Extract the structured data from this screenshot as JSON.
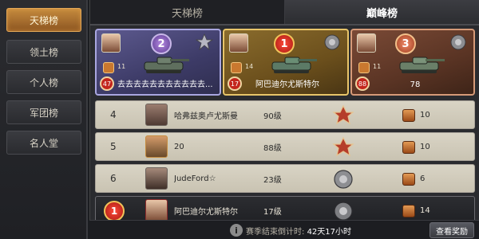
{
  "sidebar": {
    "items": [
      {
        "label": "天梯榜",
        "active": true
      },
      {
        "label": "领土榜",
        "active": false
      },
      {
        "label": "个人榜",
        "active": false
      },
      {
        "label": "军团榜",
        "active": false
      },
      {
        "label": "名人堂",
        "active": false
      }
    ]
  },
  "tabs": [
    {
      "label": "天梯榜",
      "active": false
    },
    {
      "label": "巅峰榜",
      "active": true
    }
  ],
  "top3": [
    {
      "rank": "2",
      "mini_value": "11",
      "level": "47",
      "name": "去去去去去去去去去去去..."
    },
    {
      "rank": "1",
      "mini_value": "14",
      "level": "17",
      "name": "阿巴迪尔尤斯特尔"
    },
    {
      "rank": "3",
      "mini_value": "11",
      "level": "88",
      "name": "78"
    }
  ],
  "rows": [
    {
      "rank": "4",
      "name": "哈弗兹奥卢尤斯曼",
      "level": "90级",
      "score": "10"
    },
    {
      "rank": "5",
      "name": "20",
      "level": "88级",
      "score": "10"
    },
    {
      "rank": "6",
      "name": "JudeFord☆",
      "level": "23级",
      "score": "6"
    }
  ],
  "me": {
    "rank": "1",
    "name": "阿巴迪尔尤斯特尔",
    "level": "17级",
    "score": "14"
  },
  "footer": {
    "countdown_label": "赛季结束倒计时:",
    "countdown_value": "42天17小时",
    "reward_button": "查看奖励"
  },
  "colors": {
    "accent": "#c58b3e",
    "rank1": "#e8c56a",
    "rank2": "#a9a6e0",
    "rank3": "#d69a78"
  }
}
